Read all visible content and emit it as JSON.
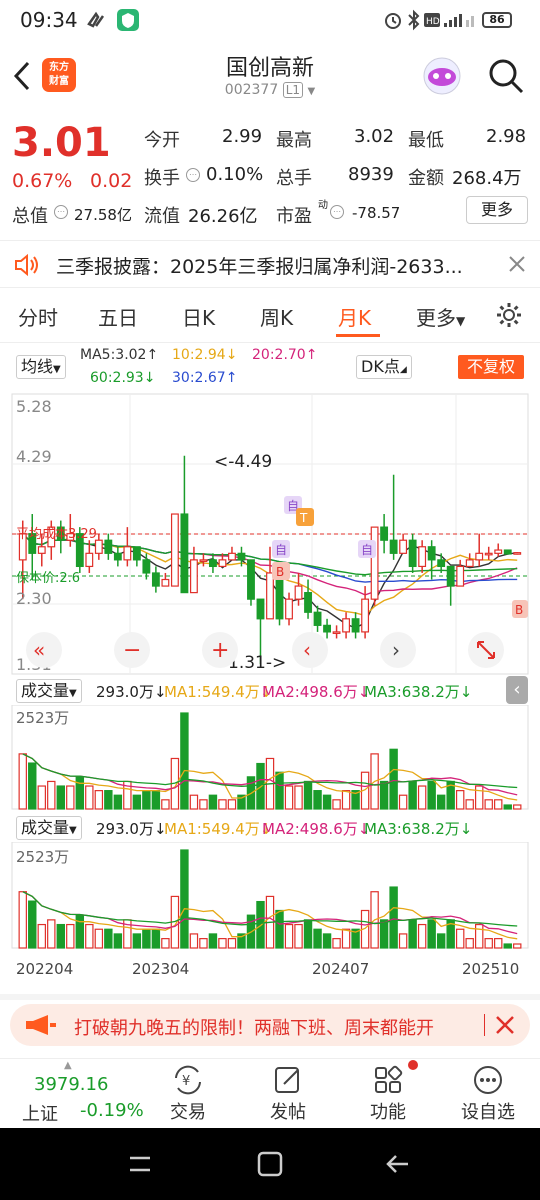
{
  "status_bar": {
    "time": "09:34",
    "battery": "86"
  },
  "header": {
    "logo_line1": "东方",
    "logo_line2": "财富",
    "stock_name": "国创高新",
    "stock_code": "002377",
    "board_badge": "L1"
  },
  "quote": {
    "price": "3.01",
    "change_pct": "0.67%",
    "change": "0.02",
    "open_label": "今开",
    "open": "2.99",
    "high_label": "最高",
    "high": "3.02",
    "low_label": "最低",
    "low": "2.98",
    "turnover_label": "换手",
    "turnover": "0.10%",
    "volume_label": "总手",
    "volume": "8939",
    "amount_label": "金额",
    "amount": "268.4万",
    "mktcap_label": "总值",
    "mktcap": "27.58亿",
    "float_label": "流值",
    "float": "26.26亿",
    "pe_label": "市盈",
    "pe_sup": "动",
    "pe": "-78.57",
    "more_button": "更多"
  },
  "notice": {
    "text": "三季报披露：2025年三季报归属净利润-2633..."
  },
  "tabs": [
    {
      "label": "分时"
    },
    {
      "label": "五日"
    },
    {
      "label": "日K"
    },
    {
      "label": "周K"
    },
    {
      "label": "月K",
      "active": true
    },
    {
      "label": "更多"
    }
  ],
  "chart_controls": {
    "ma_selector": "均线",
    "dk_button": "DK点",
    "adjust_button": "不复权",
    "ma5": "MA5:3.02↑",
    "ma10": "10:2.94↓",
    "ma20": "20:2.70↑",
    "ma60": "60:2.93↓",
    "ma30": "30:2.67↑"
  },
  "kline_labels": {
    "y_ticks": [
      "5.28",
      "4.29",
      "2.30",
      "1.31"
    ],
    "max_label": "<-4.49",
    "min_label": "1.31->",
    "avg_cost": "平均成本3.29",
    "break_even": "保本价:2.6",
    "markers": [
      "自",
      "T",
      "自",
      "B",
      "自",
      "B"
    ]
  },
  "volume_panels": [
    {
      "selector": "成交量",
      "vol": "293.0万↓",
      "ma1": "MA1:549.4万↓",
      "ma2": "MA2:498.6万↓",
      "ma3": "MA3:638.2万↓",
      "top_label": "2523万"
    },
    {
      "selector": "成交量",
      "vol": "293.0万↓",
      "ma1": "MA1:549.4万↓",
      "ma2": "MA2:498.6万↓",
      "ma3": "MA3:638.2万↓",
      "top_label": "2523万"
    }
  ],
  "x_axis": [
    "202204",
    "202304",
    "202407",
    "202510"
  ],
  "banner": {
    "text": "打破朝九晚五的限制！两融下班、周末都能开"
  },
  "bottom_bar": {
    "index_value": "3979.16",
    "index_name": "上证",
    "index_change": "-0.19%",
    "items": [
      "交易",
      "发帖",
      "功能",
      "设自选"
    ]
  },
  "colors": {
    "up": "#e0302a",
    "down": "#1a9c2a",
    "accent": "#ff5a1f"
  },
  "chart_data": {
    "type": "candlestick",
    "ylim": [
      1.31,
      5.28
    ],
    "candles": [
      [
        2.9,
        3.3,
        3.5,
        2.3
      ],
      [
        3.3,
        3.0,
        3.6,
        2.6
      ],
      [
        3.0,
        3.1,
        3.3,
        2.8
      ],
      [
        3.1,
        3.4,
        3.5,
        2.9
      ],
      [
        3.4,
        3.2,
        3.5,
        3.0
      ],
      [
        3.2,
        3.3,
        3.6,
        3.1
      ],
      [
        3.3,
        2.8,
        3.4,
        2.7
      ],
      [
        2.8,
        3.0,
        3.2,
        2.7
      ],
      [
        3.0,
        3.2,
        3.3,
        2.9
      ],
      [
        3.2,
        3.0,
        3.3,
        2.9
      ],
      [
        3.0,
        2.9,
        3.1,
        2.8
      ],
      [
        2.9,
        3.1,
        3.4,
        2.8
      ],
      [
        3.1,
        2.9,
        3.1,
        2.8
      ],
      [
        2.9,
        2.7,
        3.0,
        2.6
      ],
      [
        2.7,
        2.5,
        2.8,
        2.4
      ],
      [
        2.5,
        2.6,
        2.7,
        2.5
      ],
      [
        2.5,
        3.6,
        3.6,
        2.5
      ],
      [
        3.6,
        2.4,
        4.49,
        2.4
      ],
      [
        2.4,
        2.9,
        3.1,
        2.8
      ],
      [
        2.9,
        2.9,
        3.0,
        2.8
      ],
      [
        2.9,
        2.8,
        3.0,
        2.7
      ],
      [
        2.8,
        2.9,
        3.0,
        2.8
      ],
      [
        2.9,
        3.0,
        3.1,
        2.9
      ],
      [
        3.0,
        2.9,
        3.1,
        2.8
      ],
      [
        2.9,
        2.3,
        2.9,
        2.2
      ],
      [
        2.3,
        2.0,
        2.3,
        1.31
      ],
      [
        2.0,
        2.7,
        3.1,
        2.0
      ],
      [
        2.7,
        2.0,
        2.7,
        1.9
      ],
      [
        2.0,
        2.3,
        2.4,
        1.9
      ],
      [
        2.3,
        2.5,
        2.7,
        2.2
      ],
      [
        2.4,
        2.1,
        2.6,
        2.0
      ],
      [
        2.1,
        1.9,
        2.2,
        1.8
      ],
      [
        1.9,
        1.8,
        2.0,
        1.7
      ],
      [
        1.8,
        1.8,
        1.9,
        1.7
      ],
      [
        1.8,
        2.0,
        2.1,
        1.7
      ],
      [
        2.0,
        1.8,
        2.1,
        1.7
      ],
      [
        1.8,
        2.3,
        2.5,
        1.7
      ],
      [
        2.3,
        3.4,
        3.4,
        2.2
      ],
      [
        3.4,
        3.2,
        3.6,
        3.0
      ],
      [
        3.2,
        3.0,
        4.2,
        2.9
      ],
      [
        3.0,
        3.2,
        3.3,
        3.0
      ],
      [
        3.2,
        2.8,
        3.3,
        2.7
      ],
      [
        2.8,
        3.1,
        3.2,
        2.7
      ],
      [
        3.1,
        2.9,
        3.2,
        2.6
      ],
      [
        2.9,
        2.8,
        3.0,
        2.7
      ],
      [
        2.8,
        2.5,
        2.8,
        2.2
      ],
      [
        2.5,
        2.8,
        2.9,
        2.5
      ],
      [
        2.8,
        2.9,
        3.0,
        2.8
      ],
      [
        2.9,
        3.0,
        3.3,
        2.8
      ],
      [
        3.0,
        3.0,
        3.1,
        2.9
      ],
      [
        3.0,
        3.05,
        3.15,
        2.95
      ],
      [
        3.05,
        2.99,
        3.02,
        2.98
      ],
      [
        2.99,
        3.01,
        3.02,
        2.98
      ]
    ],
    "volume_max": 2523
  }
}
